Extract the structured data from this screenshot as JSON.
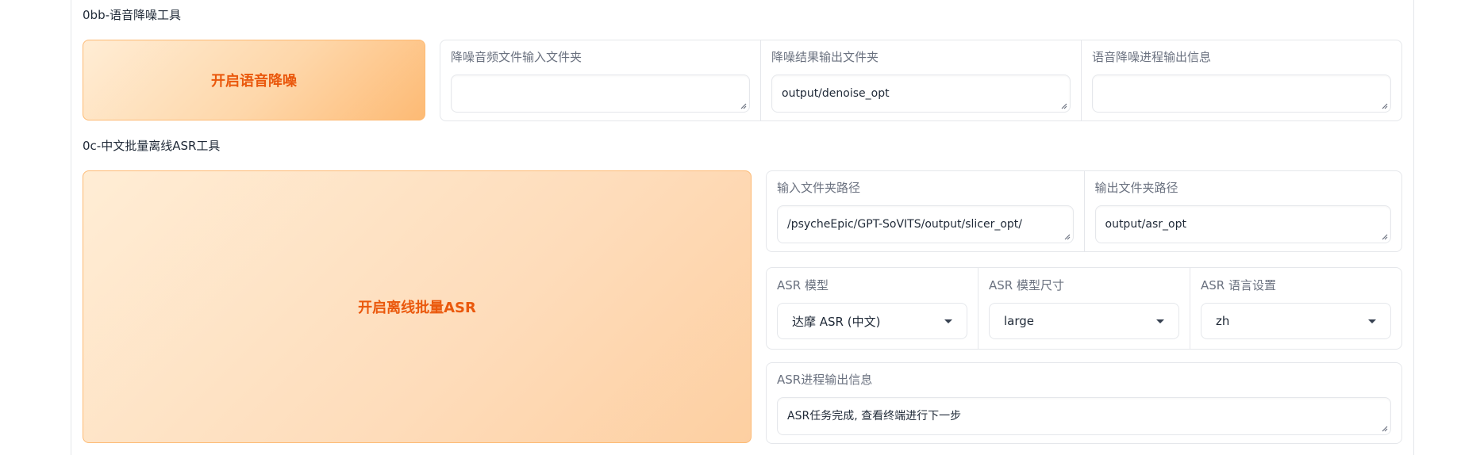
{
  "denoise": {
    "section_title": "0bb-语音降噪工具",
    "button_label": "开启语音降噪",
    "input_folder": {
      "label": "降噪音频文件输入文件夹",
      "value": ""
    },
    "output_folder": {
      "label": "降噪结果输出文件夹",
      "value": "output/denoise_opt"
    },
    "progress": {
      "label": "语音降噪进程输出信息",
      "value": ""
    }
  },
  "asr": {
    "section_title": "0c-中文批量离线ASR工具",
    "button_label": "开启离线批量ASR",
    "input_path": {
      "label": "输入文件夹路径",
      "value": "/psycheEpic/GPT-SoVITS/output/slicer_opt/"
    },
    "output_path": {
      "label": "输出文件夹路径",
      "value": "output/asr_opt"
    },
    "model": {
      "label": "ASR 模型",
      "value": "达摩 ASR (中文)"
    },
    "model_size": {
      "label": "ASR 模型尺寸",
      "value": "large"
    },
    "language": {
      "label": "ASR 语言设置",
      "value": "zh"
    },
    "progress": {
      "label": "ASR进程输出信息",
      "value": "ASR任务完成, 查看终端进行下一步"
    }
  },
  "icons": {
    "resize": "resize-handle-icon",
    "dropdown": "chevron-down-icon"
  },
  "colors": {
    "accent": "#ea580c",
    "button_gradient_start": "#ffedd5",
    "button_gradient_end": "#fdba74",
    "border": "#e5e7eb"
  }
}
